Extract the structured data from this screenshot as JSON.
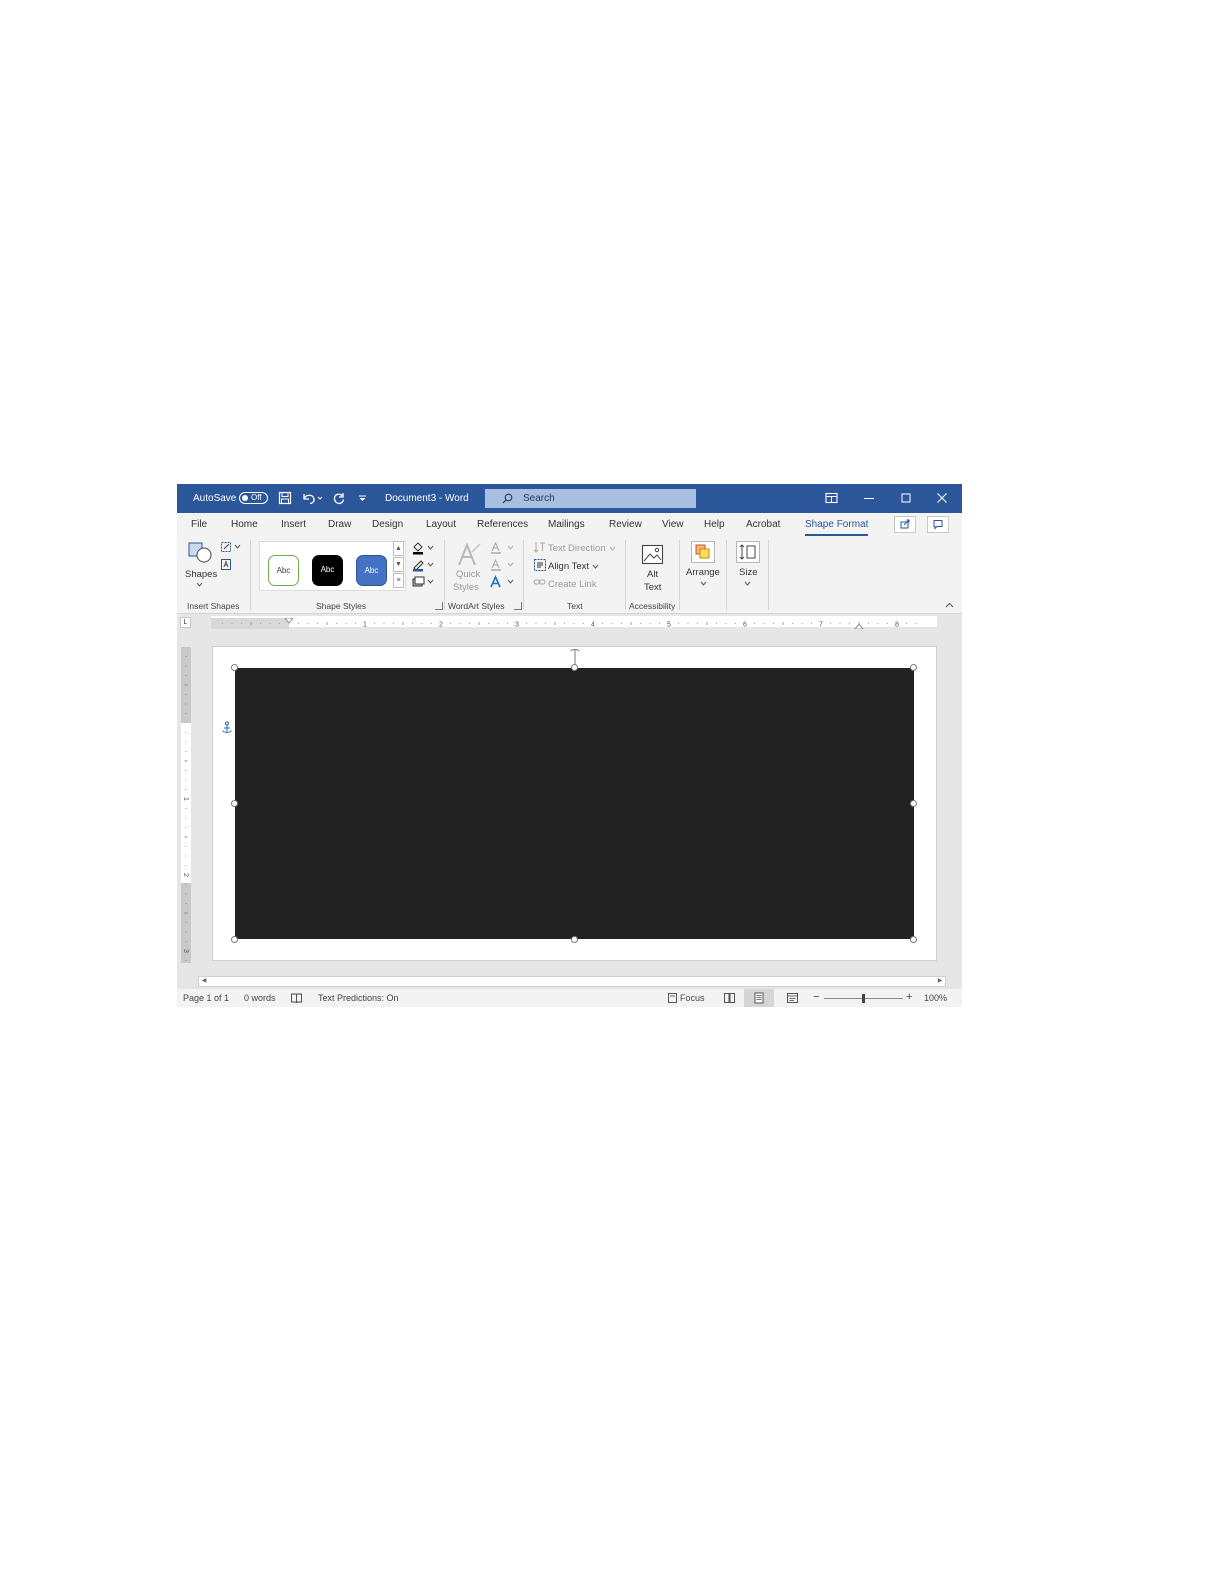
{
  "titlebar": {
    "autosave_label": "AutoSave",
    "autosave_state": "Off",
    "document_title": "Document3 - Word",
    "search_placeholder": "Search"
  },
  "tabs": [
    {
      "label": "File"
    },
    {
      "label": "Home"
    },
    {
      "label": "Insert"
    },
    {
      "label": "Draw"
    },
    {
      "label": "Design"
    },
    {
      "label": "Layout"
    },
    {
      "label": "References"
    },
    {
      "label": "Mailings"
    },
    {
      "label": "Review"
    },
    {
      "label": "View"
    },
    {
      "label": "Help"
    },
    {
      "label": "Acrobat"
    },
    {
      "label": "Shape Format",
      "active": true
    }
  ],
  "ribbon": {
    "insert_shapes": {
      "shapes_label": "Shapes",
      "group_label": "Insert Shapes"
    },
    "shape_styles": {
      "styles": [
        "Abc",
        "Abc",
        "Abc"
      ],
      "group_label": "Shape Styles"
    },
    "wordart_styles": {
      "quick_label": "Quick",
      "styles_label": "Styles",
      "group_label": "WordArt Styles"
    },
    "text": {
      "text_direction": "Text Direction",
      "align_text": "Align Text",
      "create_link": "Create Link",
      "group_label": "Text"
    },
    "accessibility": {
      "alt_label": "Alt",
      "text_label": "Text",
      "group_label": "Accessibility"
    },
    "arrange": {
      "label": "Arrange"
    },
    "size": {
      "label": "Size"
    }
  },
  "ruler": {
    "numbers": [
      "1",
      "2",
      "3",
      "4",
      "5",
      "6",
      "7",
      "8"
    ],
    "vertical_numbers": [
      "1",
      "2",
      "3"
    ],
    "tab_selector": "L"
  },
  "status": {
    "page": "Page 1 of 1",
    "words": "0 words",
    "predictions": "Text Predictions: On",
    "focus": "Focus",
    "zoom": "100%"
  },
  "colors": {
    "title_bar": "#2b579a",
    "shape_fill": "#222222",
    "accent_style_fill": "#4472c4",
    "outline_style_border": "#70ad47"
  }
}
